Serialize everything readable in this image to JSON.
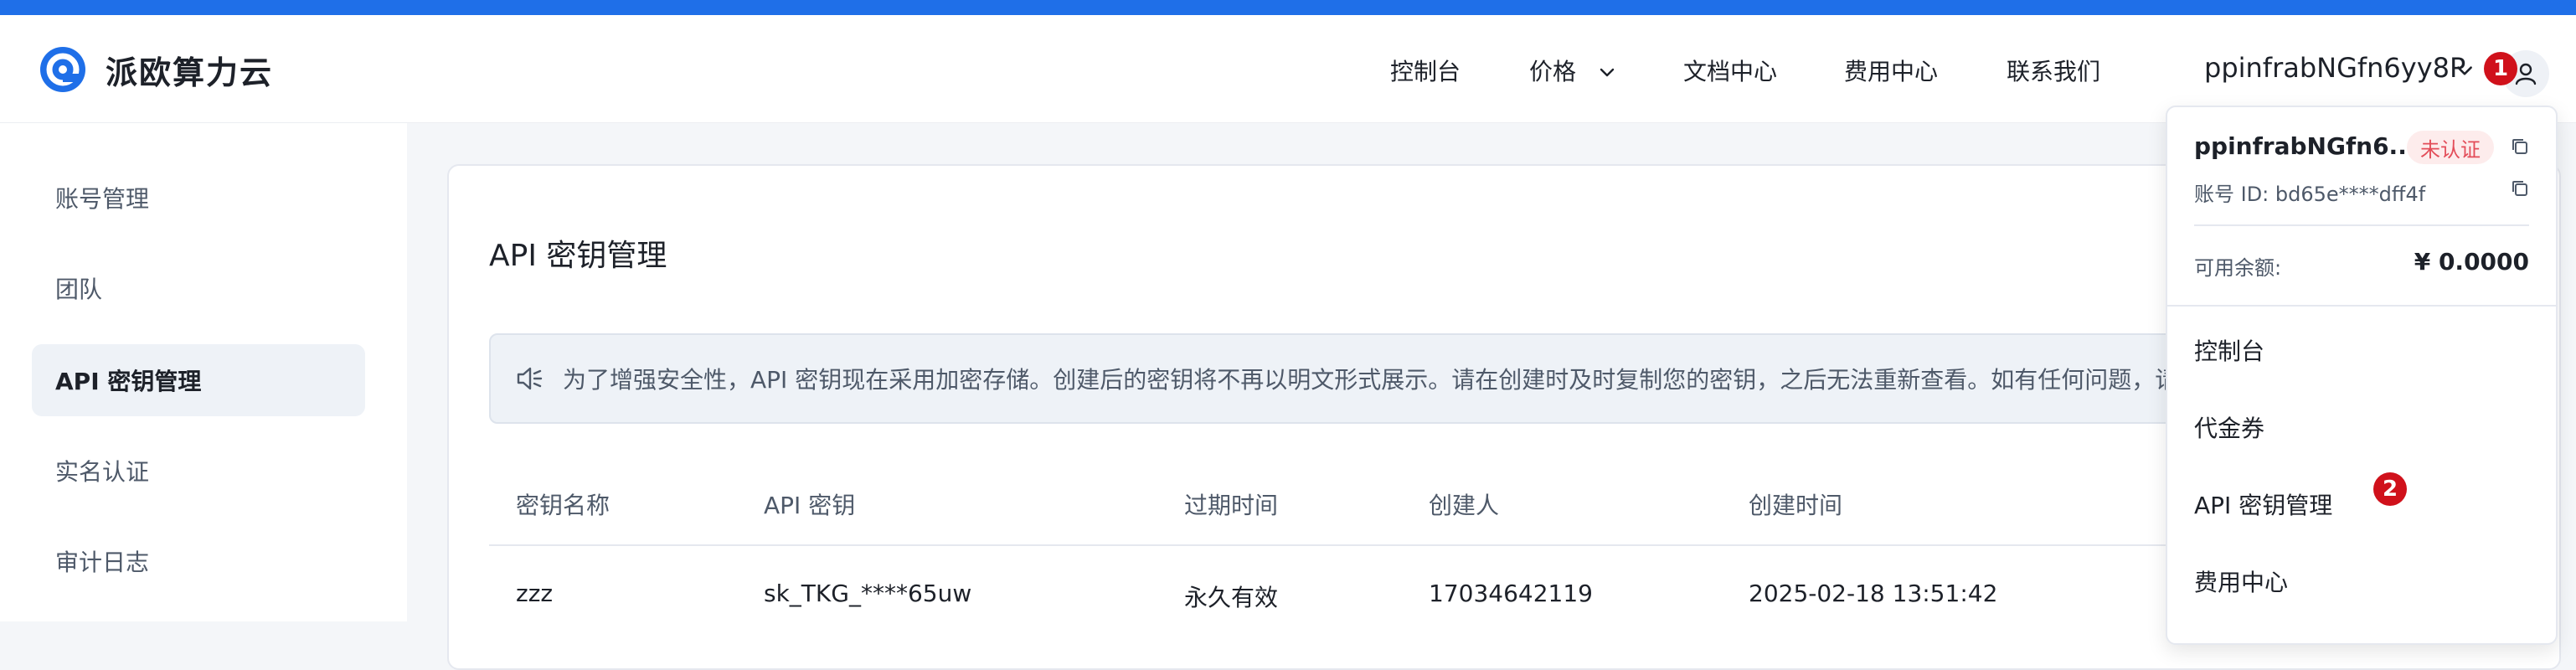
{
  "brand": {
    "name": "派欧算力云"
  },
  "nav": {
    "console": "控制台",
    "pricing": "价格",
    "docs": "文档中心",
    "billing": "费用中心",
    "contact": "联系我们"
  },
  "user": {
    "name": "ppinfrabNGfn6yy8P"
  },
  "badges": {
    "first": "1",
    "second": "2"
  },
  "sidebar": {
    "items": [
      {
        "label": "账号管理"
      },
      {
        "label": "团队"
      },
      {
        "label": "API 密钥管理"
      },
      {
        "label": "实名认证"
      },
      {
        "label": "审计日志"
      }
    ]
  },
  "main": {
    "title": "API 密钥管理",
    "notice": "为了增强安全性，API 密钥现在采用加密存储。创建后的密钥将不再以明文形式展示。请在创建时及时复制您的密钥，之后无法重新查看。如有任何问题，请",
    "columns": [
      "密钥名称",
      "API 密钥",
      "过期时间",
      "创建人",
      "创建时间"
    ],
    "rows": [
      {
        "name": "zzz",
        "key": "sk_TKG_****65uw",
        "expiry": "永久有效",
        "creator": "17034642119",
        "created_at": "2025-02-18 13:51:42"
      }
    ]
  },
  "dropdown": {
    "name": "ppinfrabNGfn6...",
    "status_tag": "未认证",
    "account_id": "账号 ID: bd65e****dff4f",
    "balance_label": "可用余额:",
    "balance_value": "¥ 0.0000",
    "menu": [
      {
        "label": "控制台"
      },
      {
        "label": "代金券"
      },
      {
        "label": "API 密钥管理"
      },
      {
        "label": "费用中心"
      }
    ]
  },
  "colors": {
    "accent": "#1f6fe8",
    "badge": "#d0111b",
    "tag_text": "#e34d59",
    "tag_bg": "#fdecec"
  },
  "icons": {
    "logo": "logo-icon",
    "caret": "chevron-down-icon",
    "user": "user-icon",
    "notice": "speaker-icon",
    "copy": "copy-icon"
  }
}
